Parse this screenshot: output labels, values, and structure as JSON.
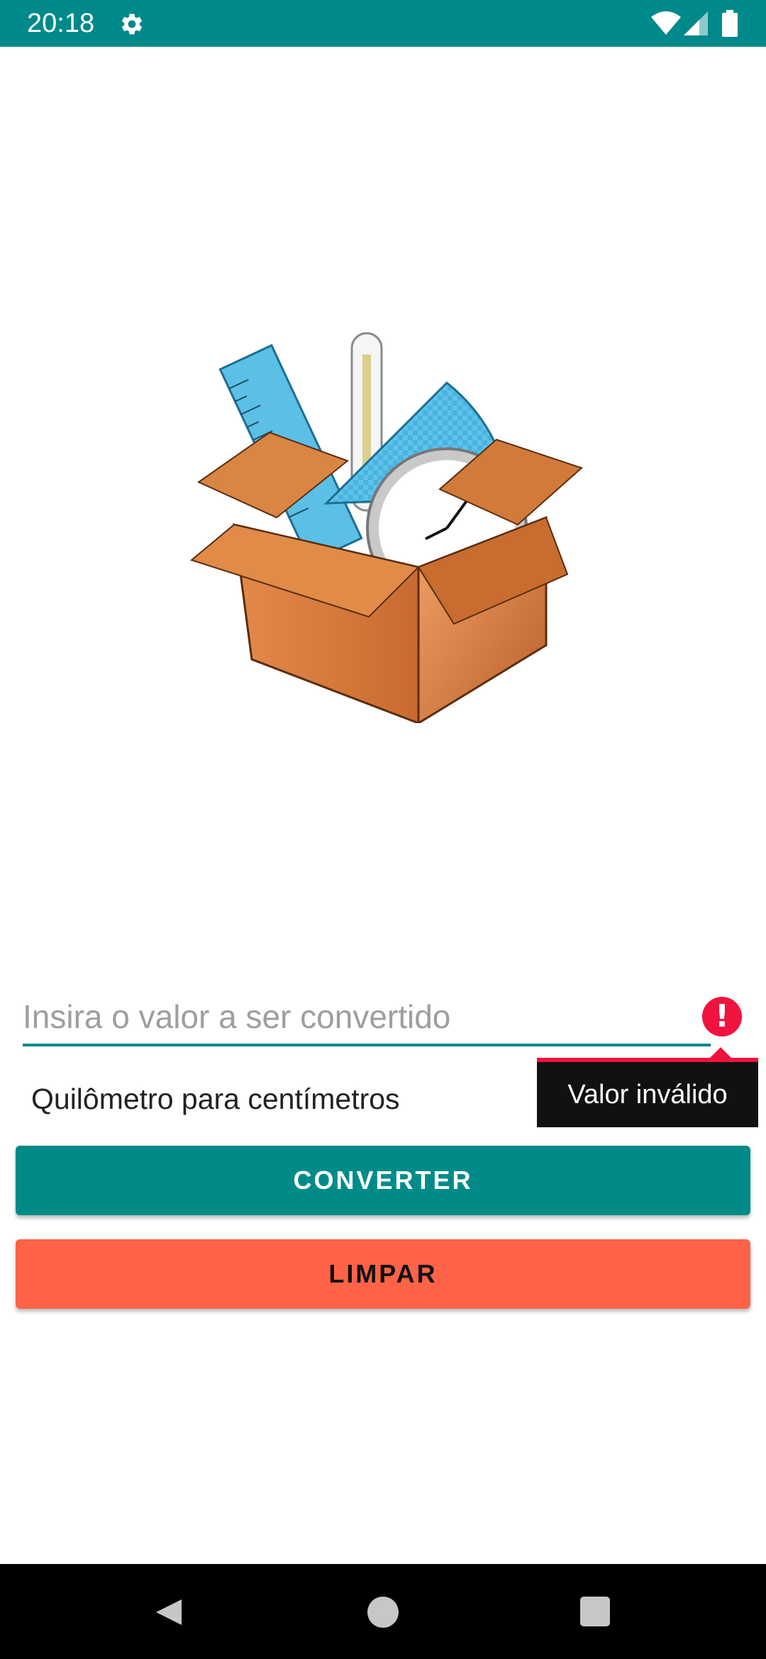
{
  "status_bar": {
    "time": "20:18",
    "settings_icon": "gear-icon",
    "wifi_icon": "wifi-icon",
    "signal_icon": "cell-signal-icon",
    "battery_icon": "battery-icon",
    "background_color": "#00898a"
  },
  "hero": {
    "image": "toolbox-with-ruler-thermometer-protractor-scale"
  },
  "input": {
    "placeholder": "Insira o valor a ser convertido",
    "value": "",
    "error_icon": "error-icon",
    "error_message": "Valor inválido",
    "error_color": "#f0133f"
  },
  "conversion": {
    "selected": "Quilômetro para centímetros"
  },
  "buttons": {
    "convert_label": "CONVERTER",
    "clear_label": "LIMPAR",
    "convert_color": "#008b89",
    "clear_color": "#ff6347"
  },
  "nav_bar": {
    "back_icon": "back-triangle-icon",
    "home_icon": "home-circle-icon",
    "recent_icon": "recent-apps-square-icon"
  }
}
